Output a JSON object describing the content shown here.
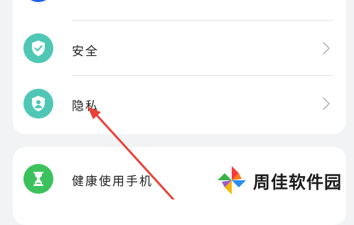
{
  "settings": {
    "items": [
      {
        "label": "安全",
        "icon": "shield-check-icon",
        "icon_color": "#4fc7b4"
      },
      {
        "label": "隐私",
        "icon": "privacy-shield-icon",
        "icon_color": "#4fc7b4"
      },
      {
        "label": "健康使用手机",
        "icon": "hourglass-icon",
        "icon_color": "#3cc25d"
      }
    ]
  },
  "watermark": {
    "text": "周佳软件园"
  },
  "annotation": {
    "color": "#e8423a"
  }
}
